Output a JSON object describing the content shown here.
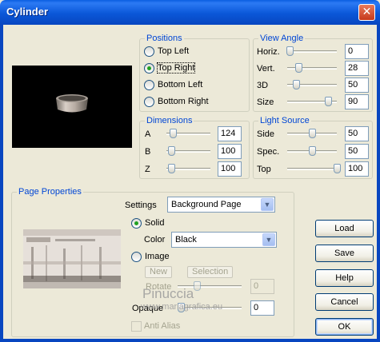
{
  "window": {
    "title": "Cylinder",
    "close_glyph": "✕"
  },
  "positions": {
    "title": "Positions",
    "options": [
      {
        "label": "Top Left",
        "checked": false
      },
      {
        "label": "Top Right",
        "checked": true
      },
      {
        "label": "Bottom Left",
        "checked": false
      },
      {
        "label": "Bottom Right",
        "checked": false
      }
    ]
  },
  "view_angle": {
    "title": "View Angle",
    "rows": [
      {
        "label": "Horiz.",
        "value": "0"
      },
      {
        "label": "Vert.",
        "value": "28"
      },
      {
        "label": "3D",
        "value": "50"
      },
      {
        "label": "Size",
        "value": "90"
      }
    ]
  },
  "dimensions": {
    "title": "Dimensions",
    "rows": [
      {
        "label": "A",
        "value": "124"
      },
      {
        "label": "B",
        "value": "100"
      },
      {
        "label": "Z",
        "value": "100"
      }
    ]
  },
  "light_source": {
    "title": "Light Source",
    "rows": [
      {
        "label": "Side",
        "value": "50"
      },
      {
        "label": "Spec.",
        "value": "50"
      },
      {
        "label": "Top",
        "value": "100"
      }
    ]
  },
  "page_properties": {
    "title": "Page Properties",
    "settings_label": "Settings",
    "settings_value": "Background Page",
    "solid_label": "Solid",
    "color_label": "Color",
    "color_value": "Black",
    "image_label": "Image",
    "new_label": "New",
    "selection_label": "Selection",
    "rotate_label": "Rotate",
    "rotate_value": "0",
    "opaque_label": "Opaque",
    "opaque_value": "0",
    "anti_alias_label": "Anti Alias"
  },
  "buttons": {
    "load": "Load",
    "save": "Save",
    "help": "Help",
    "cancel": "Cancel",
    "ok": "OK"
  },
  "watermark": {
    "name": "Pinuccia",
    "url": "www.mariagrafica.eu"
  },
  "colors": {
    "titlebar": "#0A57D8",
    "dialog_bg": "#ECE9D8",
    "group_title": "#0046D5",
    "radio_dot": "#21A121"
  }
}
